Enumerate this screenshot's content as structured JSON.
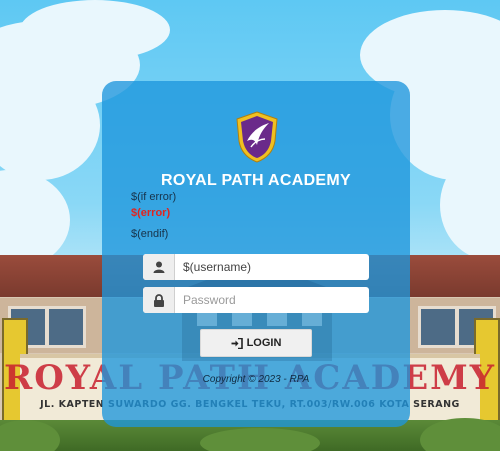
{
  "school": {
    "name": "ROYAL PATH ACADEMY",
    "banner_title": "ROYAL PATH ACADEMY",
    "banner_address": "JL. KAPTEN SUWARDO GG. BENGKEL TEKU, RT.003/RW.006 KOTA SERANG"
  },
  "template": {
    "if_error": "$(if error)",
    "error": "$(error)",
    "endif": "$(endif)"
  },
  "form": {
    "username_value": "$(username)",
    "password_placeholder": "Password",
    "login_label": "LOGIN"
  },
  "footer": {
    "copyright": "Copyright © 2023 - RPA"
  },
  "colors": {
    "card": "#1e96dc",
    "error": "#e0241f",
    "sign_title": "#c8202e"
  }
}
